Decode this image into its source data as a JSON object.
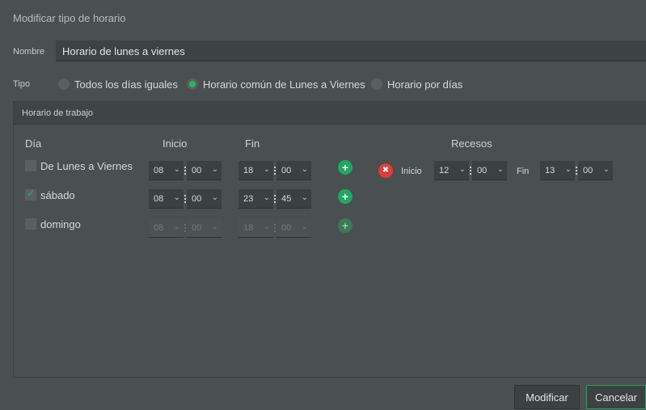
{
  "dialog": {
    "title": "Modificar tipo de horario"
  },
  "nombre": {
    "label": "Nombre",
    "value": "Horario de lunes a viernes"
  },
  "tipo": {
    "label": "Tipo",
    "options": [
      {
        "label": "Todos los días iguales",
        "selected": false
      },
      {
        "label": "Horario común de Lunes a Viernes",
        "selected": true
      },
      {
        "label": "Horario por días",
        "selected": false
      }
    ]
  },
  "panel": {
    "title": "Horario de trabajo",
    "headers": {
      "dia": "Día",
      "inicio": "Inicio",
      "fin": "Fin",
      "recesos": "Recesos"
    },
    "rows": [
      {
        "day": "De Lunes a Viernes",
        "checked": false,
        "enabled": true,
        "inicio_h": "08",
        "inicio_m": "00",
        "fin_h": "18",
        "fin_m": "00"
      },
      {
        "day": "sábado",
        "checked": true,
        "enabled": true,
        "inicio_h": "08",
        "inicio_m": "00",
        "fin_h": "23",
        "fin_m": "45"
      },
      {
        "day": "domingo",
        "checked": false,
        "enabled": false,
        "inicio_h": "08",
        "inicio_m": "00",
        "fin_h": "18",
        "fin_m": "00"
      }
    ],
    "receso": {
      "inicio_label": "Inicio",
      "inicio_h": "12",
      "inicio_m": "00",
      "fin_label": "Fin",
      "fin_h": "13",
      "fin_m": "00"
    }
  },
  "icons": {
    "add": "+",
    "remove": "✖",
    "chevron": "⌄"
  },
  "colors": {
    "accent": "#1fa862",
    "danger": "#e03c3c",
    "background": "#4a4f4f"
  },
  "buttons": {
    "modify": "Modificar",
    "cancel": "Cancelar"
  }
}
